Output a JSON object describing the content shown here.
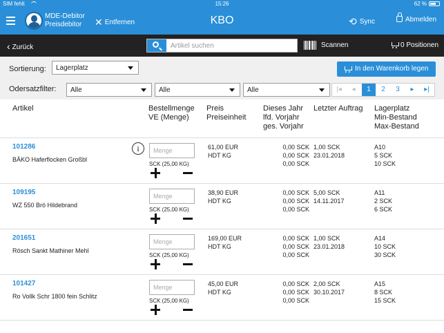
{
  "statusbar": {
    "carrier": "SIM fehlt",
    "time": "15:26",
    "battery": "62 %"
  },
  "appbar": {
    "debitor_line1": "MDE-Debitor",
    "debitor_line2": "Preisdebitor",
    "remove_label": "Entfernen",
    "title": "KBO",
    "sync_label": "Sync",
    "logout_label": "Abmelden"
  },
  "toolbar": {
    "back_label": "Zurück",
    "search_placeholder": "Artikel suchen",
    "scan_label": "Scannen",
    "positions_label": "0 Positionen"
  },
  "controls": {
    "sort_label": "Sortierung:",
    "sort_value": "Lagerplatz",
    "basket_button": "In den Warenkorb legen",
    "filter_label": "Odersatzfilter:",
    "filter1": "Alle",
    "filter2": "Alle",
    "filter3": "Alle",
    "pager": {
      "pages": [
        "1",
        "2",
        "3"
      ],
      "current": "1"
    }
  },
  "table": {
    "headers": {
      "artikel": "Artikel",
      "bestell_1": "Bestellmenge",
      "bestell_2": "VE (Menge)",
      "preis_1": "Preis",
      "preis_2": "Preiseinheit",
      "jahr_1": "Dieses Jahr",
      "jahr_2": "lfd. Vorjahr",
      "jahr_3": "ges. Vorjahr",
      "auftrag": "Letzter Auftrag",
      "lager_1": "Lagerplatz",
      "lager_2": "Min-Bestand",
      "lager_3": "Max-Bestand"
    },
    "qty_placeholder": "Menge",
    "unit_note": "SCK (25,00 KG)",
    "rows": [
      {
        "code": "101286",
        "name": "BÄKO Haferflocken Großbl",
        "price": "61,00 EUR",
        "price_unit": "HDT KG",
        "y1": "0,00 SCK",
        "y2": "0,00 SCK",
        "y3": "0,00 SCK",
        "last_qty": "1,00 SCK",
        "last_date": "23.01.2018",
        "loc": "A10",
        "min": "5 SCK",
        "max": "10 SCK"
      },
      {
        "code": "109195",
        "name": "WZ 550 Brö Hildebrand",
        "price": "38,90 EUR",
        "price_unit": "HDT KG",
        "y1": "0,00 SCK",
        "y2": "0,00 SCK",
        "y3": "0,00 SCK",
        "last_qty": "5,00 SCK",
        "last_date": "14.11.2017",
        "loc": "A11",
        "min": "2 SCK",
        "max": "6 SCK"
      },
      {
        "code": "201651",
        "name": "Rösch Sankt Mathiner Mehl",
        "price": "169,00 EUR",
        "price_unit": "HDT KG",
        "y1": "0,00 SCK",
        "y2": "0,00 SCK",
        "y3": "0,00 SCK",
        "last_qty": "1,00 SCK",
        "last_date": "23.01.2018",
        "loc": "A14",
        "min": "10 SCK",
        "max": "30 SCK"
      },
      {
        "code": "101427",
        "name": "Ro Vollk Schr 1800 fein Schlitz",
        "price": "45,00 EUR",
        "price_unit": "HDT KG",
        "y1": "0,00 SCK",
        "y2": "0,00 SCK",
        "y3": "0,00 SCK",
        "last_qty": "2,00 SCK",
        "last_date": "30.10.2017",
        "loc": "A15",
        "min": "8 SCK",
        "max": "15 SCK"
      }
    ]
  }
}
